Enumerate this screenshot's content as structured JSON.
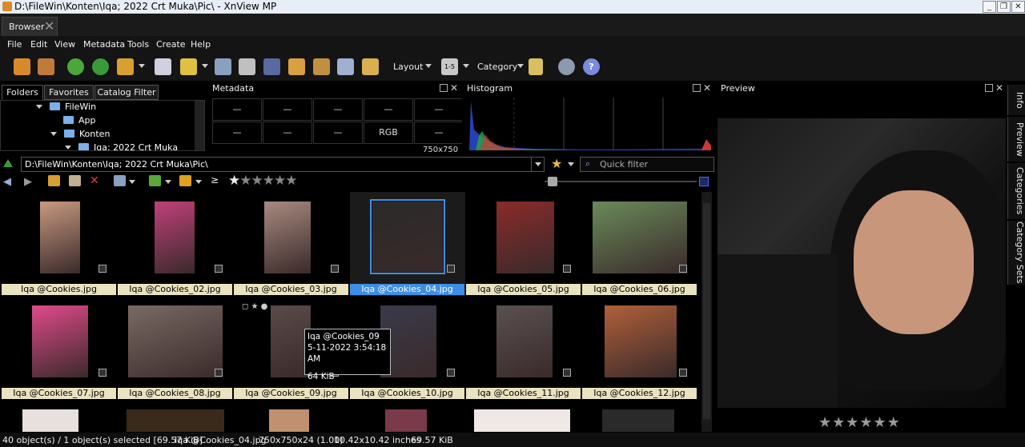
{
  "window": {
    "title": "D:\\FileWin\\Konten\\Iqa; 2022 Crt Muka\\Pic\\ - XnView MP"
  },
  "tab": {
    "label": "Browser"
  },
  "menu": [
    "File",
    "Edit",
    "View",
    "Metadata",
    "Tools",
    "Create",
    "Help"
  ],
  "toolbar": {
    "layout_label": "Layout",
    "category_label": "Category"
  },
  "panels": {
    "folders_tabs": [
      "Folders",
      "Favorites",
      "Catalog Filter"
    ],
    "metadata_title": "Metadata",
    "histogram_title": "Histogram",
    "preview_title": "Preview"
  },
  "folders": [
    {
      "name": "FileWin",
      "level": 0
    },
    {
      "name": "App",
      "level": 1
    },
    {
      "name": "Konten",
      "level": 1
    },
    {
      "name": "Iqa; 2022 Crt Muka",
      "level": 2
    }
  ],
  "metadata": {
    "row1": [
      "—",
      "—",
      "—",
      "—",
      "—"
    ],
    "row2": [
      "—",
      "—",
      "—",
      "RGB",
      "—"
    ],
    "partial": "750x750"
  },
  "path": "D:\\FileWin\\Konten\\Iqa; 2022 Crt Muka\\Pic\\",
  "filter_placeholder": "Quick filter",
  "thumbnails": [
    {
      "name": "Iqa @Cookies.jpg",
      "color": "#c79a80"
    },
    {
      "name": "Iqa @Cookies_02.jpg",
      "color": "#c0407a"
    },
    {
      "name": "Iqa @Cookies_03.jpg",
      "color": "#a88a80"
    },
    {
      "name": "Iqa @Cookies_04.jpg",
      "color": "#2a2a2a",
      "selected": true
    },
    {
      "name": "Iqa @Cookies_05.jpg",
      "color": "#8a2a2a"
    },
    {
      "name": "Iqa @Cookies_06.jpg",
      "color": "#6a8a5a"
    },
    {
      "name": "Iqa @Cookies_07.jpg",
      "color": "#e04a8a"
    },
    {
      "name": "Iqa @Cookies_08.jpg",
      "color": "#7a6a64"
    },
    {
      "name": "Iqa @Cookies_09.jpg",
      "color": "#5a4a48"
    },
    {
      "name": "Iqa @Cookies_10.jpg",
      "color": "#3a3a4a"
    },
    {
      "name": "Iqa @Cookies_11.jpg",
      "color": "#5a5050"
    },
    {
      "name": "Iqa @Cookies_12.jpg",
      "color": "#b0603a"
    }
  ],
  "tooltip": {
    "name": "Iqa @Cookies_09",
    "date": "5-11-2022 3:54:18 AM",
    "size": "64 KiB"
  },
  "side_tabs": [
    "Info",
    "Preview",
    "Categories",
    "Category Sets"
  ],
  "status": {
    "count": "40 object(s) / 1 object(s) selected [69.57 KiB]",
    "file": "Iqa @Cookies_04.jpg",
    "dims": "750x750x24 (1.00)",
    "inches": "10.42x10.42 inches",
    "size": "69.57 KiB"
  },
  "colors": {
    "accent": "#3d8ee6",
    "caption": "#e9e3c0",
    "background": "#000000"
  }
}
